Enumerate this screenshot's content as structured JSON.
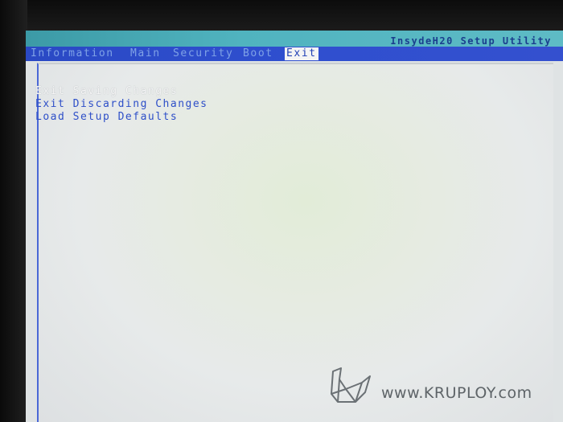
{
  "title_bar": {
    "utility_title": "InsydeH20 Setup Utility"
  },
  "menu": {
    "items": [
      {
        "label": "Information",
        "active": false
      },
      {
        "label": "Main",
        "active": false
      },
      {
        "label": "Security",
        "active": false
      },
      {
        "label": "Boot",
        "active": false
      },
      {
        "label": "Exit",
        "active": true
      }
    ]
  },
  "exit_page": {
    "options": [
      {
        "label": "Exit Saving Changes",
        "selected": true
      },
      {
        "label": "Exit Discarding Changes",
        "selected": false
      },
      {
        "label": "Load Setup Defaults",
        "selected": false
      }
    ]
  },
  "watermark": {
    "text": "www.KRUPLOY.com",
    "icon": "crane-logo-icon"
  },
  "colors": {
    "title_bar": "#50b3bf",
    "menu_bar": "#2f4fcf",
    "screen_background": "#e5e9e6",
    "option_text": "#2e4fc8",
    "selected_option_text": "#f6f6f6"
  }
}
